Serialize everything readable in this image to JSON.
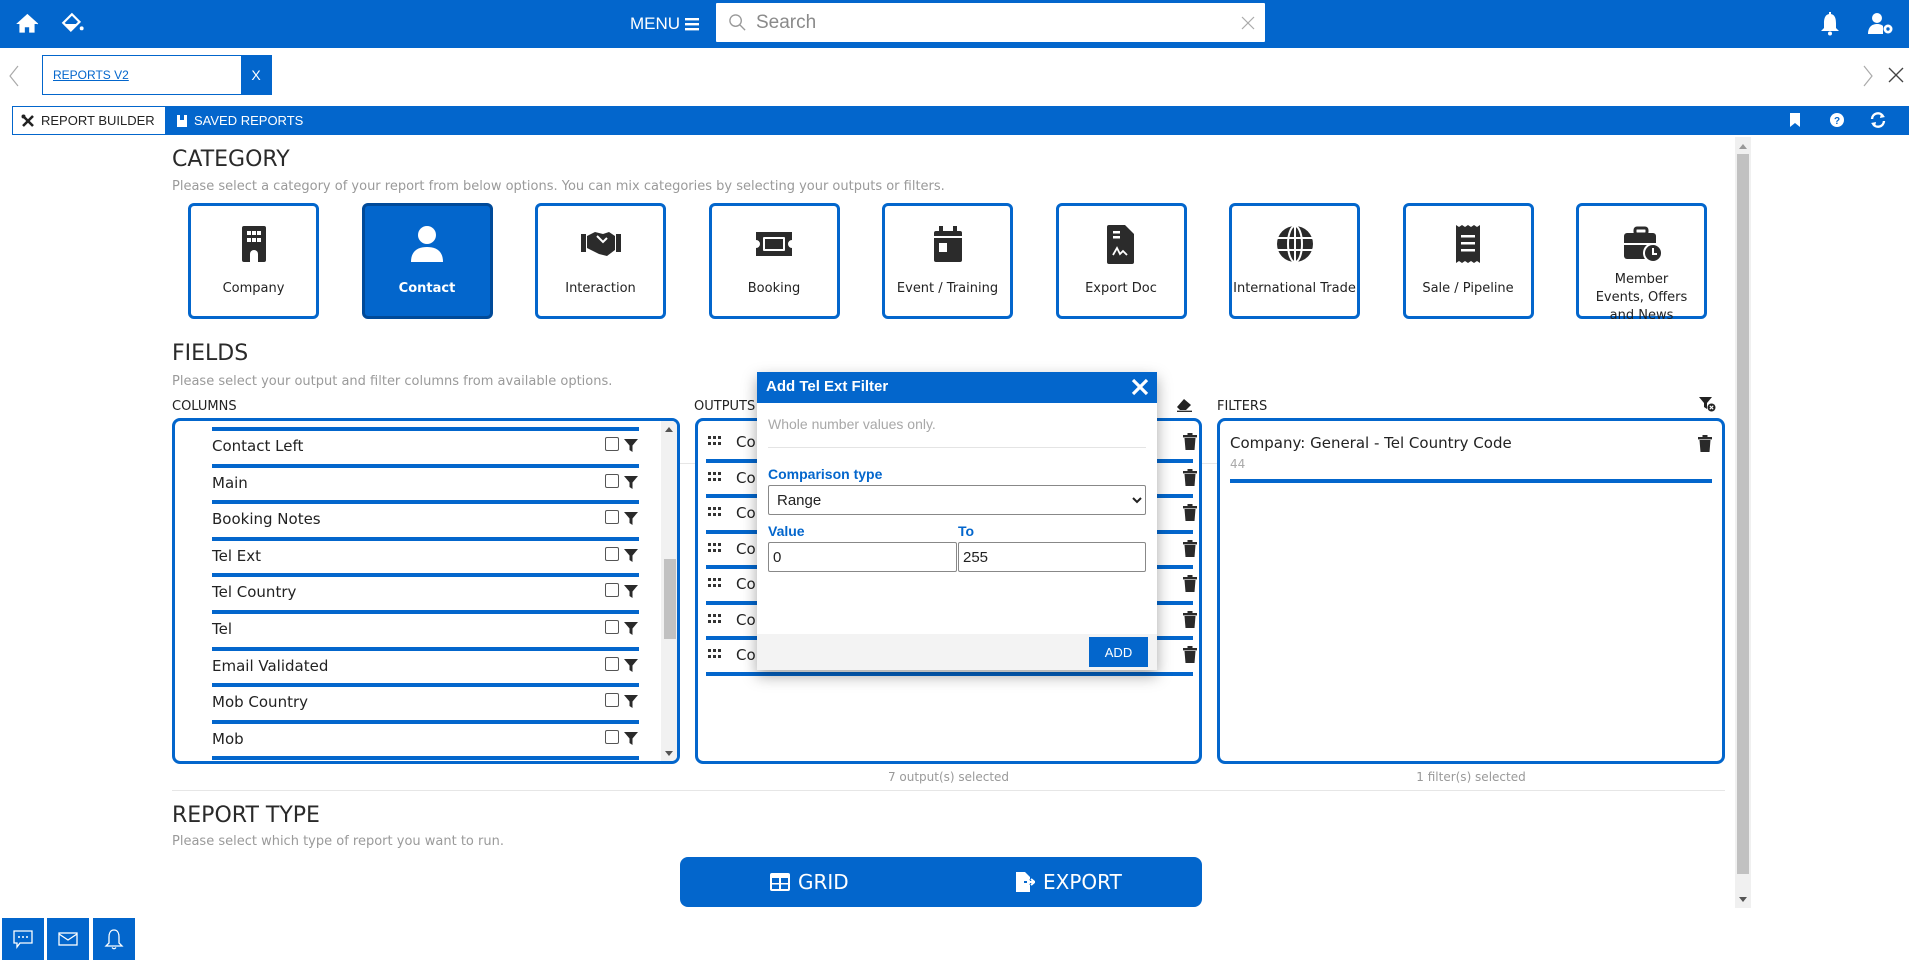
{
  "topbar": {
    "menu_label": "MENU",
    "search_placeholder": "Search",
    "icons": [
      "home-icon",
      "paint-bucket-icon",
      "bell-icon",
      "user-settings-icon"
    ]
  },
  "tabs": {
    "open_tab_label": "REPORTS V2",
    "close_label": "X"
  },
  "toolbar": {
    "report_builder_label": "REPORT BUILDER",
    "saved_reports_label": "SAVED REPORTS",
    "icons": [
      "bookmark-icon",
      "help-icon",
      "refresh-icon"
    ]
  },
  "category": {
    "title": "CATEGORY",
    "subtitle": "Please select a category of your report from below options. You can mix categories by selecting your outputs or filters.",
    "items": [
      {
        "label": "Company",
        "icon": "building-icon",
        "active": false
      },
      {
        "label": "Contact",
        "icon": "user-icon",
        "active": true
      },
      {
        "label": "Interaction",
        "icon": "handshake-icon",
        "active": false
      },
      {
        "label": "Booking",
        "icon": "ticket-icon",
        "active": false
      },
      {
        "label": "Event / Training",
        "icon": "calendar-icon",
        "active": false
      },
      {
        "label": "Export Doc",
        "icon": "document-signature-icon",
        "active": false
      },
      {
        "label": "International Trade",
        "icon": "globe-icon",
        "active": false
      },
      {
        "label": "Sale / Pipeline",
        "icon": "receipt-icon",
        "active": false
      },
      {
        "label": "Member Events, Offers and News",
        "icon": "briefcase-clock-icon",
        "active": false
      }
    ]
  },
  "fields": {
    "title": "FIELDS",
    "subtitle": "Please select your output and filter columns from available options.",
    "columns_label": "COLUMNS",
    "outputs_label": "OUTPUTS",
    "filters_label": "FILTERS",
    "columns": [
      {
        "label": "Contact Left",
        "checked": false
      },
      {
        "label": "Main",
        "checked": false
      },
      {
        "label": "Booking Notes",
        "checked": false
      },
      {
        "label": "Tel Ext",
        "checked": false
      },
      {
        "label": "Tel Country",
        "checked": false
      },
      {
        "label": "Tel",
        "checked": false
      },
      {
        "label": "Email Validated",
        "checked": false
      },
      {
        "label": "Mob Country",
        "checked": false
      },
      {
        "label": "Mob",
        "checked": false
      }
    ],
    "outputs": [
      {
        "label": "Co"
      },
      {
        "label": "Co"
      },
      {
        "label": "Co"
      },
      {
        "label": "Co"
      },
      {
        "label": "Co"
      },
      {
        "label": "Co"
      },
      {
        "label": "Co"
      }
    ],
    "filters": [
      {
        "label": "Company: General - Tel Country Code",
        "value": "44"
      }
    ],
    "outputs_count": "7 output(s) selected",
    "filters_count": "1 filter(s) selected"
  },
  "modal": {
    "title": "Add Tel Ext Filter",
    "hint": "Whole number values only.",
    "comparison_label": "Comparison type",
    "comparison_value": "Range",
    "value_label": "Value",
    "value": "0",
    "to_label": "To",
    "to_value": "255",
    "add_label": "ADD"
  },
  "report_type": {
    "title": "REPORT TYPE",
    "subtitle": "Please select which type of report you want to run.",
    "grid_label": "GRID",
    "export_label": "EXPORT"
  },
  "colors": {
    "primary": "#0366cc",
    "active_border": "#004a99"
  }
}
